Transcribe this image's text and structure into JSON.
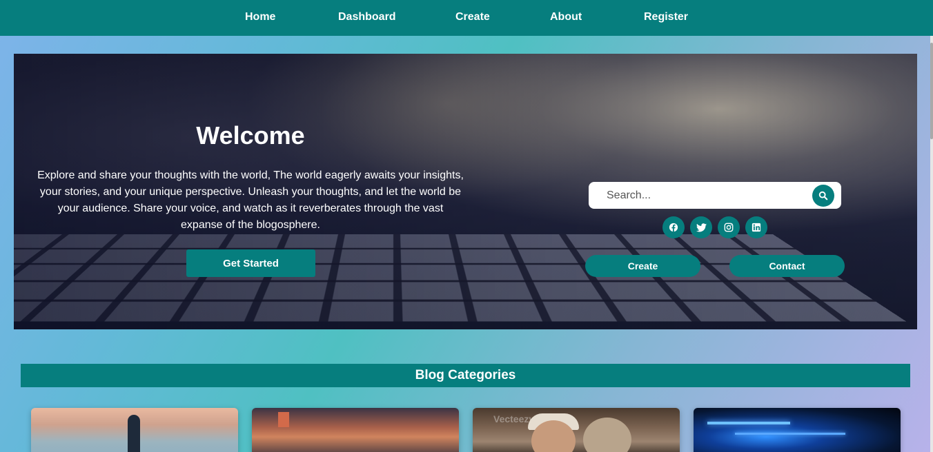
{
  "nav": {
    "items": [
      "Home",
      "Dashboard",
      "Create",
      "About",
      "Register"
    ]
  },
  "hero": {
    "title": "Welcome",
    "text": "Explore and share your thoughts with the world, The world eagerly awaits your insights, your stories, and your unique perspective. Unleash your thoughts, and let the world be your audience. Share your voice, and watch as it reverberates through the vast expanse of the blogosphere.",
    "cta_label": "Get Started"
  },
  "search": {
    "placeholder": "Search...",
    "value": ""
  },
  "social": {
    "icons": [
      "facebook-icon",
      "twitter-icon",
      "instagram-icon",
      "linkedin-icon"
    ]
  },
  "actions": {
    "create_label": "Create",
    "contact_label": "Contact"
  },
  "categories": {
    "heading": "Blog Categories",
    "watermark": "Vecteezy"
  },
  "colors": {
    "brand": "#067e7e",
    "white": "#ffffff"
  }
}
